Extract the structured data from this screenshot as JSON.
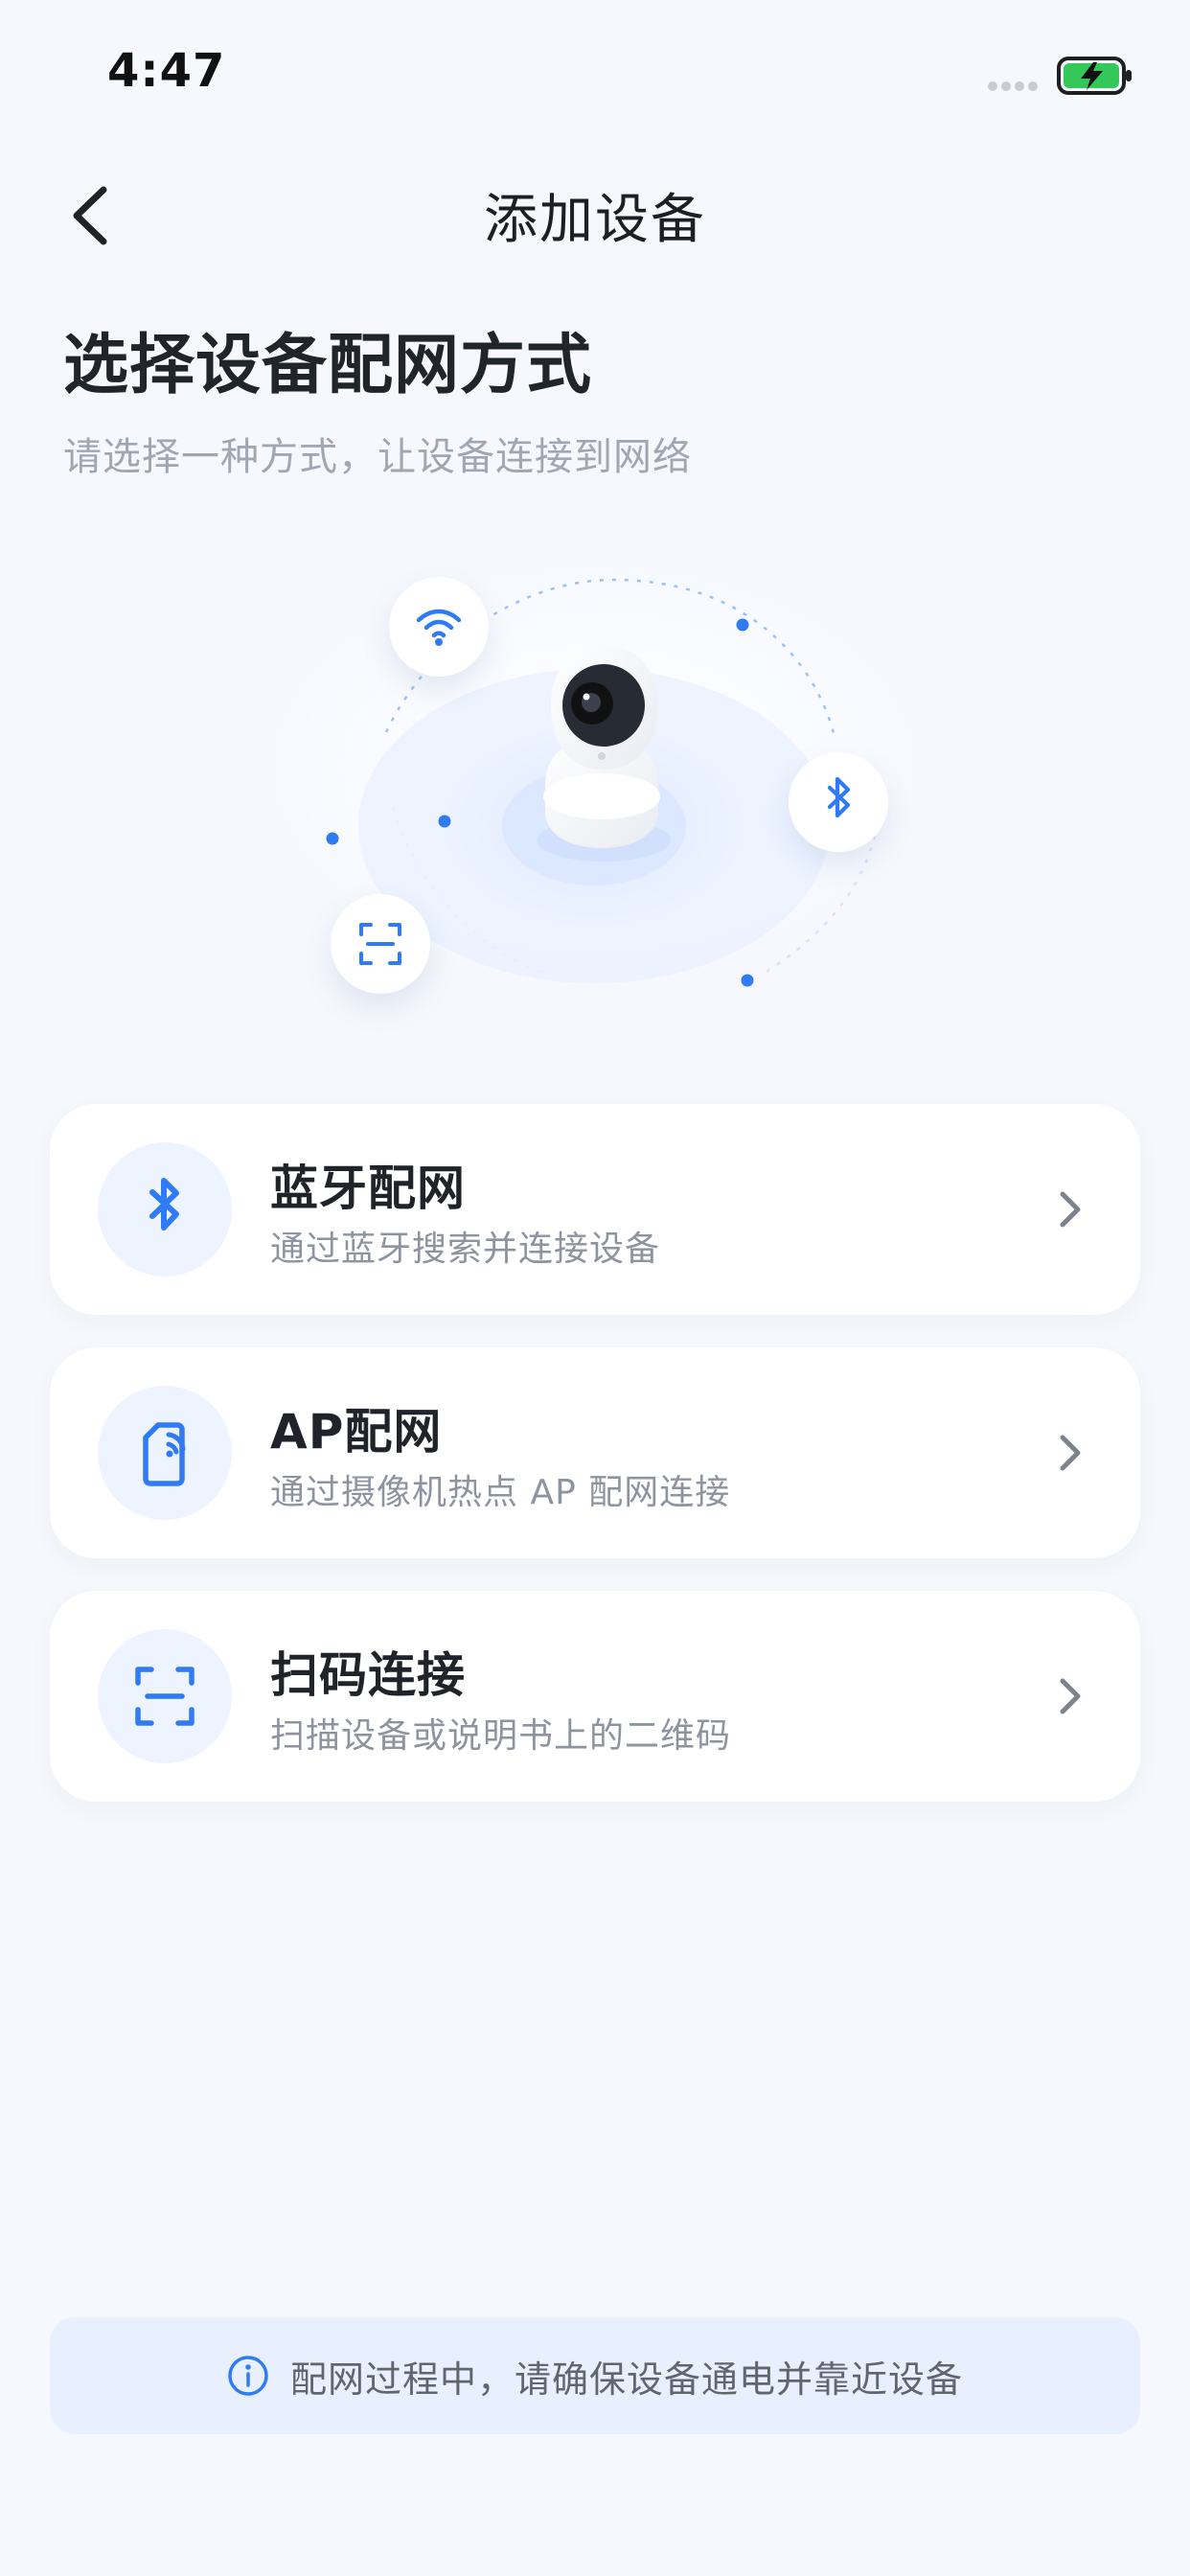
{
  "status_bar": {
    "time": "4:47"
  },
  "header": {
    "title": "添加设备"
  },
  "intro": {
    "title": "选择设备配网方式",
    "subtitle": "请选择一种方式，让设备连接到网络"
  },
  "illustration": {
    "icons": [
      "wifi-icon",
      "bluetooth-icon",
      "scan-icon",
      "camera-device"
    ]
  },
  "options": [
    {
      "title": "蓝牙配网",
      "description": "通过蓝牙搜索并连接设备",
      "icon": "bluetooth-icon"
    },
    {
      "title": "AP配网",
      "description": "通过摄像机热点 AP 配网连接",
      "icon": "ap-signal-icon"
    },
    {
      "title": "扫码连接",
      "description": "扫描设备或说明书上的二维码",
      "icon": "scan-icon"
    }
  ],
  "notice": {
    "text": "配网过程中，请确保设备通电并靠近设备",
    "icon": "info-icon"
  },
  "colors": {
    "background": "#f6f8fd",
    "primary": "#2f7bf6",
    "icon_background": "#edf3ff",
    "card": "#ffffff",
    "notice_background": "#e8f0ff",
    "battery_green": "#34c759"
  }
}
